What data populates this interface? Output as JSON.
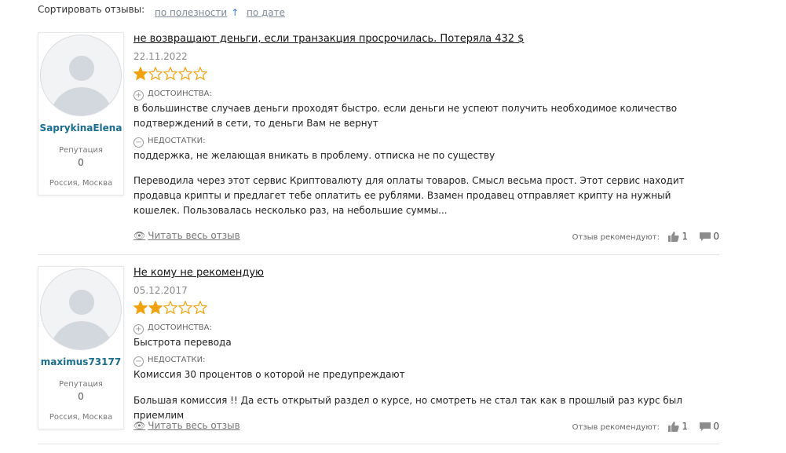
{
  "sort": {
    "label": "Сортировать отзывы:",
    "by_usefulness": "по полезности",
    "by_usefulness_arrow": "↑",
    "by_date": "по дате"
  },
  "colors": {
    "star_filled": "#f0a20e",
    "star_empty": "#f0a20e",
    "username": "#1a6d8f",
    "link": "#7d8a99"
  },
  "reviews": [
    {
      "username": "SaprykinaElena",
      "reputation_label": "Репутация",
      "reputation_value": "0",
      "location": "Россия, Москва",
      "title": "не возвращают деньги, если транзакция просрочилась. Потеряла 432 $",
      "date": "22.11.2022",
      "rating": 1,
      "rating_max": 5,
      "pros_label": "ДОСТОИНСТВА:",
      "pros_text": "в большинстве случаев деньги проходят быстро. если деньги не успеют получить необходимое количество подтверждений в сети, то деньги Вам не вернут",
      "cons_label": "НЕДОСТАТКИ:",
      "cons_text": "поддержка, не желающая вникать в проблему. отписка не по существу",
      "body": "Переводила через этот сервис Криптовалюту для оплаты товаров. Смысл весьма прост. Этот сервис находит продавца крипты и предлагет тебе оплатить ее рублями. Взамен продавец отправляет крипту на нужный кошелек. Пользовалась несколько раз, на небольшие суммы...",
      "read_more": "Читать весь отзыв",
      "recommend_label": "Отзыв рекомендуют:",
      "likes": "1",
      "comments": "0"
    },
    {
      "username": "maximus73177",
      "reputation_label": "Репутация",
      "reputation_value": "0",
      "location": "Россия, Москва",
      "title": "Не кому не рекомендую",
      "date": "05.12.2017",
      "rating": 2,
      "rating_max": 5,
      "pros_label": "ДОСТОИНСТВА:",
      "pros_text": "Быстрота перевода",
      "cons_label": "НЕДОСТАТКИ:",
      "cons_text": "Комиссия 30 процентов о которой не предупреждают",
      "body": "Большая комиссия !! Да есть открытый раздел о курсе, но смотреть не стал так как в прошлый раз курс был приемлим",
      "read_more": "Читать весь отзыв",
      "recommend_label": "Отзыв рекомендуют:",
      "likes": "1",
      "comments": "0"
    }
  ]
}
